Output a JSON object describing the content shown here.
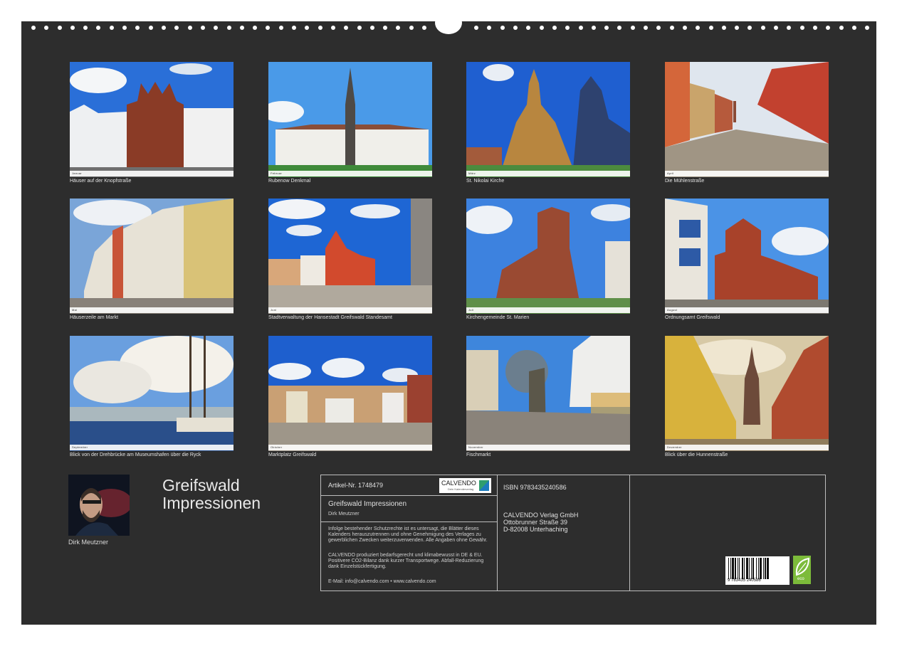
{
  "photos": [
    {
      "caption": "Häuser auf der Knopfstraße",
      "month": "Januar"
    },
    {
      "caption": "Rubenow Denkmal",
      "month": "Februar"
    },
    {
      "caption": "St. Nikolai Kirche",
      "month": "März"
    },
    {
      "caption": "Die Mühlenstraße",
      "month": "April"
    },
    {
      "caption": "Häuserzeile am Markt",
      "month": "Mai"
    },
    {
      "caption": "Stadtverwaltung der Hansestadt Greifswald Standesamt",
      "month": "Juni"
    },
    {
      "caption": "Kirchengemeinde St. Marien",
      "month": "Juli"
    },
    {
      "caption": "Ordnungsamt Greifswald",
      "month": "August"
    },
    {
      "caption": "Blick von der Drehbrücke am Museumshafen über die Ryck",
      "month": "September"
    },
    {
      "caption": "Marktplatz Greifswald",
      "month": "Oktober"
    },
    {
      "caption": "Fischmarkt",
      "month": "November"
    },
    {
      "caption": "Blick über die Hunnenstraße",
      "month": "Dezember"
    }
  ],
  "author": {
    "name": "Dirk Meutzner"
  },
  "calendar": {
    "title_line1": "Greifswald",
    "title_line2": "Impressionen"
  },
  "info": {
    "article_no": "Artikel-Nr. 1748479",
    "logo_text": "CALVENDO",
    "logo_subtext": "Dein Kalenderverlag",
    "product_title": "Greifswald Impressionen",
    "product_author": "Dirk Meutzner",
    "legal_1": "Infolge bestehender Schutzrechte ist es untersagt, die Blätter dieses Kalenders herauszutrennen und ohne Genehmigung des Verlages zu gewerblichen Zwecken weiterzuverwenden. Alle Angaben ohne Gewähr.",
    "legal_2": "CALVENDO produziert bedarfsgerecht und klimabewusst in DE & EU. Positivere CO2-Bilanz dank kurzer Transportwege. Abfall-Reduzierung dank Einzelstückfertigung.",
    "contact": "E-Mail: info@calvendo.com • www.calvendo.com",
    "isbn": "ISBN 9783435240586",
    "publisher_1": "CALVENDO Verlag GmbH",
    "publisher_2": "Ottobrunner Straße 39",
    "publisher_3": "D-82008 Unterhaching",
    "barcode_digits": "9 783435 240586",
    "eco_label": "eco"
  },
  "colors": {
    "board": "#2d2d2d",
    "caption": "#e4e4e4",
    "eco": "#7cbb3a"
  }
}
